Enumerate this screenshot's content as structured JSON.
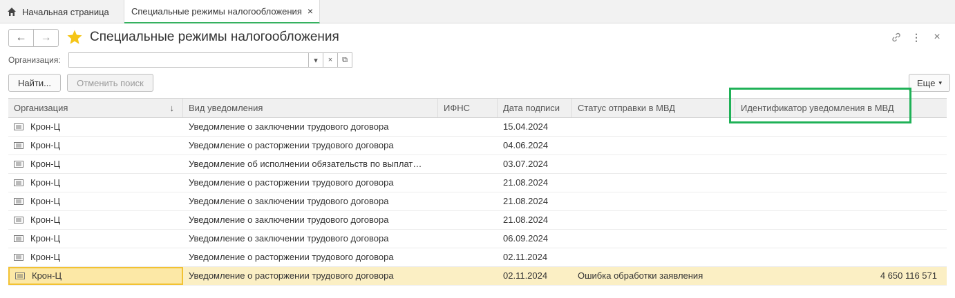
{
  "tabs": {
    "home_label": "Начальная страница",
    "active_label": "Специальные режимы налогообложения",
    "close_glyph": "×"
  },
  "header": {
    "title": "Специальные режимы налогообложения",
    "back_glyph": "←",
    "forward_glyph": "→",
    "link_icon": "link-icon",
    "menu_glyph": "⋮",
    "close_glyph": "×"
  },
  "filter": {
    "organization_label": "Организация:",
    "organization_value": "",
    "dropdown_glyph": "▾",
    "clear_glyph": "×",
    "open_glyph": "⧉"
  },
  "toolbar": {
    "find_label": "Найти...",
    "cancel_search_label": "Отменить поиск",
    "more_label": "Еще"
  },
  "table": {
    "columns": [
      "Организация",
      "Вид уведомления",
      "ИФНС",
      "Дата подписи",
      "Статус отправки в МВД",
      "Идентификатор уведомления в МВД"
    ],
    "sort_indicator": "↓",
    "rows": [
      {
        "org": "Крон-Ц",
        "type": "Уведомление о заключении трудового договора",
        "ifns": "",
        "date": "15.04.2024",
        "status": "",
        "id": ""
      },
      {
        "org": "Крон-Ц",
        "type": "Уведомление о расторжении трудового договора",
        "ifns": "",
        "date": "04.06.2024",
        "status": "",
        "id": ""
      },
      {
        "org": "Крон-Ц",
        "type": "Уведомление об исполнении обязательств по выплат…",
        "ifns": "",
        "date": "03.07.2024",
        "status": "",
        "id": ""
      },
      {
        "org": "Крон-Ц",
        "type": "Уведомление о расторжении трудового договора",
        "ifns": "",
        "date": "21.08.2024",
        "status": "",
        "id": ""
      },
      {
        "org": "Крон-Ц",
        "type": "Уведомление о заключении трудового договора",
        "ifns": "",
        "date": "21.08.2024",
        "status": "",
        "id": ""
      },
      {
        "org": "Крон-Ц",
        "type": "Уведомление о заключении трудового договора",
        "ifns": "",
        "date": "21.08.2024",
        "status": "",
        "id": ""
      },
      {
        "org": "Крон-Ц",
        "type": "Уведомление о заключении трудового договора",
        "ifns": "",
        "date": "06.09.2024",
        "status": "",
        "id": ""
      },
      {
        "org": "Крон-Ц",
        "type": "Уведомление о расторжении трудового договора",
        "ifns": "",
        "date": "02.11.2024",
        "status": "",
        "id": ""
      },
      {
        "org": "Крон-Ц",
        "type": "Уведомление о расторжении трудового договора",
        "ifns": "",
        "date": "02.11.2024",
        "status": "Ошибка обработки заявления",
        "id": "4 650 116 571",
        "selected": true
      }
    ]
  },
  "colors": {
    "accent_tab": "#35b15f",
    "highlight_box": "#1fb157",
    "selected_row": "#fbefc4",
    "star": "#f5c518"
  }
}
